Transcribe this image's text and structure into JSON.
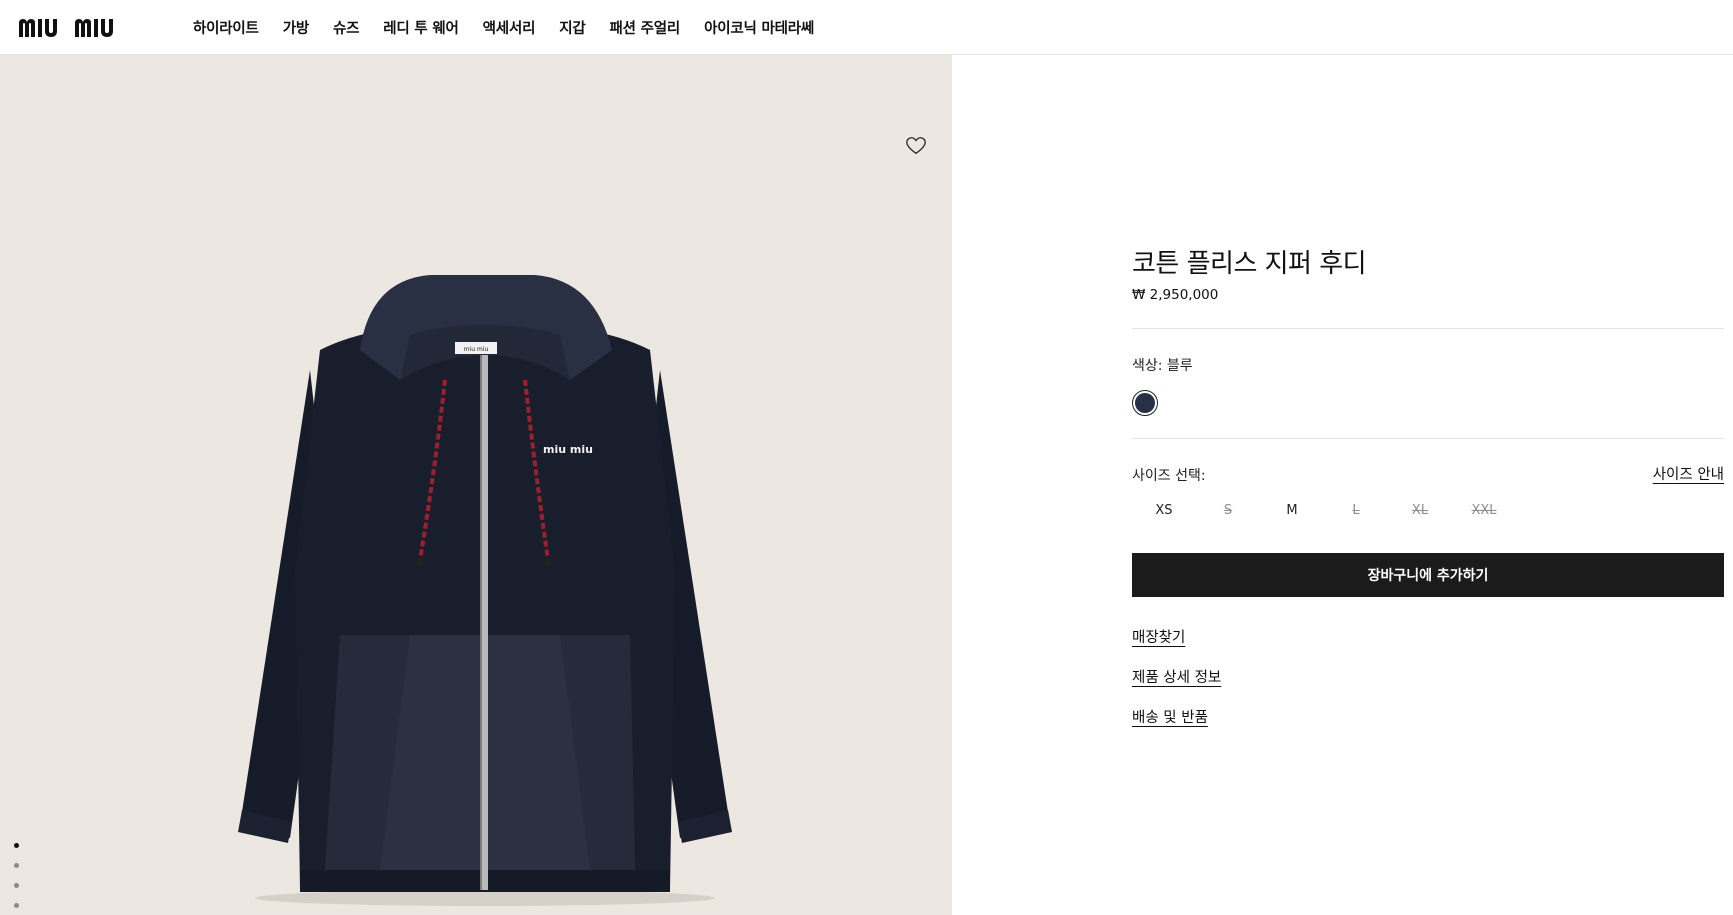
{
  "header": {
    "logo_text": "miu miu",
    "nav": [
      "하이라이트",
      "가방",
      "슈즈",
      "레디 투 웨어",
      "액세서리",
      "지갑",
      "패션 주얼리",
      "아이코닉 마테라쎄"
    ]
  },
  "gallery": {
    "wishlist_icon": "heart-outline-icon",
    "image_count": 5,
    "active_index": 0,
    "product_print": "miu miu",
    "label_print": "miu miu"
  },
  "product": {
    "title": "코튼 플리스 지퍼 후디",
    "price": "₩ 2,950,000",
    "color_label": "색상: 블루",
    "color_swatch": "#273146",
    "size_label": "사이즈 선택:",
    "size_guide": "사이즈 안내",
    "sizes": [
      {
        "label": "XS",
        "available": true
      },
      {
        "label": "S",
        "available": false
      },
      {
        "label": "M",
        "available": true
      },
      {
        "label": "L",
        "available": false
      },
      {
        "label": "XL",
        "available": false
      },
      {
        "label": "XXL",
        "available": false
      }
    ],
    "add_to_cart": "장바구니에 추가하기",
    "links": [
      "매장찾기",
      "제품 상세 정보",
      "배송 및 반품"
    ]
  },
  "colors": {
    "accent": "#1b1b1b",
    "image_bg": "#ece8e1",
    "hoodie": "#1a1f2e"
  }
}
